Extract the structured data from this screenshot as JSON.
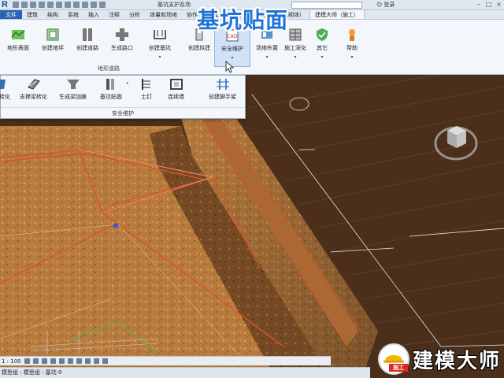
{
  "overlay_title": "基坑贴面",
  "titlebar": {
    "app_logo": "R",
    "doc_title": "基坑支护及场",
    "login_label": "登录"
  },
  "tabs": [
    {
      "label": "文件",
      "type": "file"
    },
    {
      "label": "建筑"
    },
    {
      "label": "结构"
    },
    {
      "label": "系统"
    },
    {
      "label": "插入"
    },
    {
      "label": "注释"
    },
    {
      "label": "分析"
    },
    {
      "label": "体量和场地"
    },
    {
      "label": "协作"
    },
    {
      "label": "建模大师（通用）"
    },
    {
      "label": "建模大师（砌体）"
    },
    {
      "label": "建模大师（施工）",
      "active": true
    }
  ],
  "ribbon": {
    "buttons": [
      {
        "label": "地形表面",
        "icon": "terrain-surface-icon"
      },
      {
        "label": "创建地坪",
        "icon": "create-pad-icon"
      },
      {
        "label": "创建道路",
        "icon": "create-road-icon"
      },
      {
        "label": "生成路口",
        "icon": "road-junction-icon"
      },
      {
        "label": "创建基坑",
        "icon": "create-pit-icon",
        "dropdown": true
      },
      {
        "label": "创建拟建",
        "icon": "create-proposed-icon"
      },
      {
        "label": "安全维护",
        "icon": "safety-maintenance-icon",
        "dropdown": true,
        "selected": true
      },
      {
        "label": "场地布置",
        "icon": "site-layout-icon",
        "dropdown": true
      },
      {
        "label": "施工深化",
        "icon": "construction-detail-icon",
        "dropdown": true
      },
      {
        "label": "其它",
        "icon": "other-icon",
        "dropdown": true
      },
      {
        "label": "帮助",
        "icon": "help-icon",
        "dropdown": true
      }
    ],
    "group_label": "地形道路"
  },
  "dropdown": {
    "items": [
      {
        "label": "转化",
        "icon": "convert-icon"
      },
      {
        "label": "支撑梁转化",
        "icon": "support-beam-convert-icon"
      },
      {
        "label": "生成梁加腋",
        "icon": "beam-haunch-icon"
      },
      {
        "label": "基坑贴面",
        "icon": "pit-facing-icon"
      },
      {
        "label": "土钉",
        "icon": "soil-nail-icon"
      },
      {
        "label": "连续墙",
        "icon": "diaphragm-wall-icon"
      },
      {
        "label": "创建脚手架",
        "icon": "scaffold-icon"
      }
    ],
    "footer": "安全维护"
  },
  "viewbar": {
    "scale": "1 : 100"
  },
  "statusbar": {
    "text": "模型组 : 模型组 : 基坑-0"
  },
  "watermark": {
    "text": "建模大师",
    "badge": "施工"
  },
  "colors": {
    "ribbon_bg": "#f3f6fa",
    "file_tab": "#2a63b4",
    "title_blue": "#1e73d6",
    "soil": "#b67a3c",
    "soil_dark": "#4a2f1c",
    "rebar": "#d8542a"
  }
}
